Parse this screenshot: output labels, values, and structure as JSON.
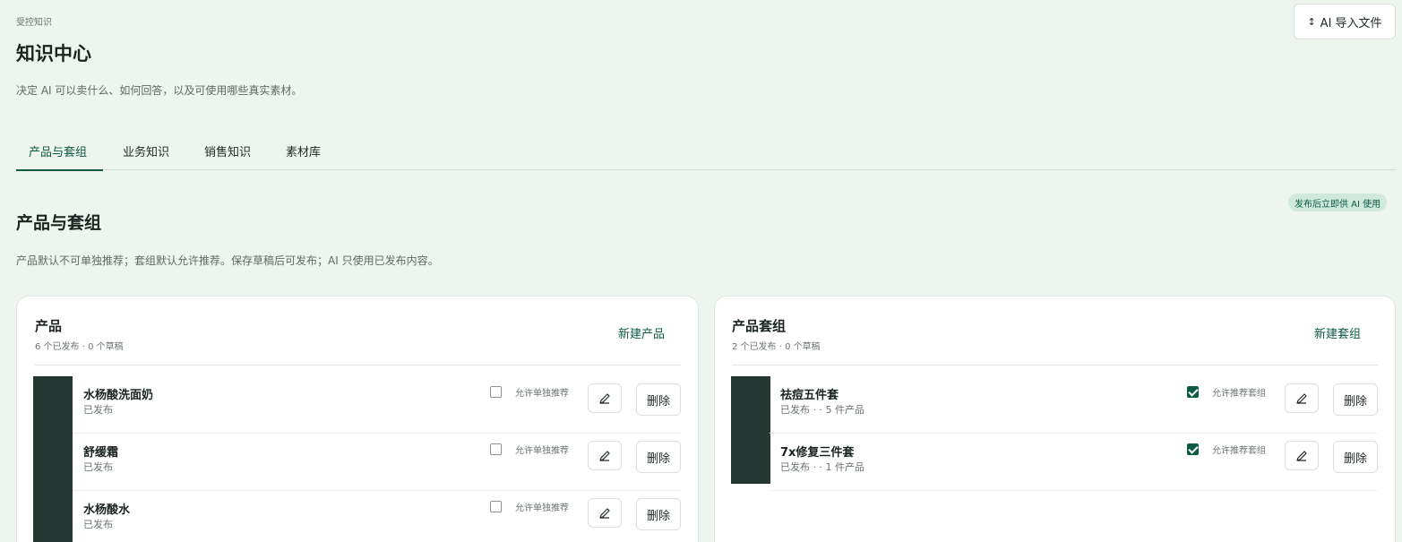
{
  "header": {
    "eyebrow": "受控知识",
    "title": "知识中心",
    "description": "决定 AI 可以卖什么、如何回答，以及可使用哪些真实素材。",
    "import_button": "AI 导入文件",
    "import_icon": "upload-arrows-icon"
  },
  "tabs": [
    {
      "label": "产品与套组",
      "active": true
    },
    {
      "label": "业务知识",
      "active": false
    },
    {
      "label": "销售知识",
      "active": false
    },
    {
      "label": "素材库",
      "active": false
    }
  ],
  "section": {
    "badge": "发布后立即供 AI 使用",
    "title": "产品与套组",
    "description": "产品默认不可单独推荐；套组默认允许推荐。保存草稿后可发布；AI 只使用已发布内容。"
  },
  "products": {
    "title": "产品",
    "summary": "6 个已发布 · 0 个草稿",
    "new_button": "新建产品",
    "checkbox_label": "允许单独推荐",
    "delete_label": "删除",
    "items": [
      {
        "name": "水杨酸洗面奶",
        "status": "已发布",
        "checked": false
      },
      {
        "name": "舒缓霜",
        "status": "已发布",
        "checked": false
      },
      {
        "name": "水杨酸水",
        "status": "已发布",
        "checked": false
      }
    ]
  },
  "bundles": {
    "title": "产品套组",
    "summary": "2 个已发布 · 0 个草稿",
    "new_button": "新建套组",
    "checkbox_label": "允许推荐套组",
    "delete_label": "删除",
    "items": [
      {
        "name": "祛痘五件套",
        "status": "已发布 · · 5 件产品",
        "checked": true
      },
      {
        "name": "7x修复三件套",
        "status": "已发布 · · 1 件产品",
        "checked": true
      }
    ]
  },
  "colors": {
    "accent": "#0d5a45",
    "background": "#eef4ee",
    "thumbnail": "#263834",
    "badge_bg": "#cfe9dc"
  }
}
